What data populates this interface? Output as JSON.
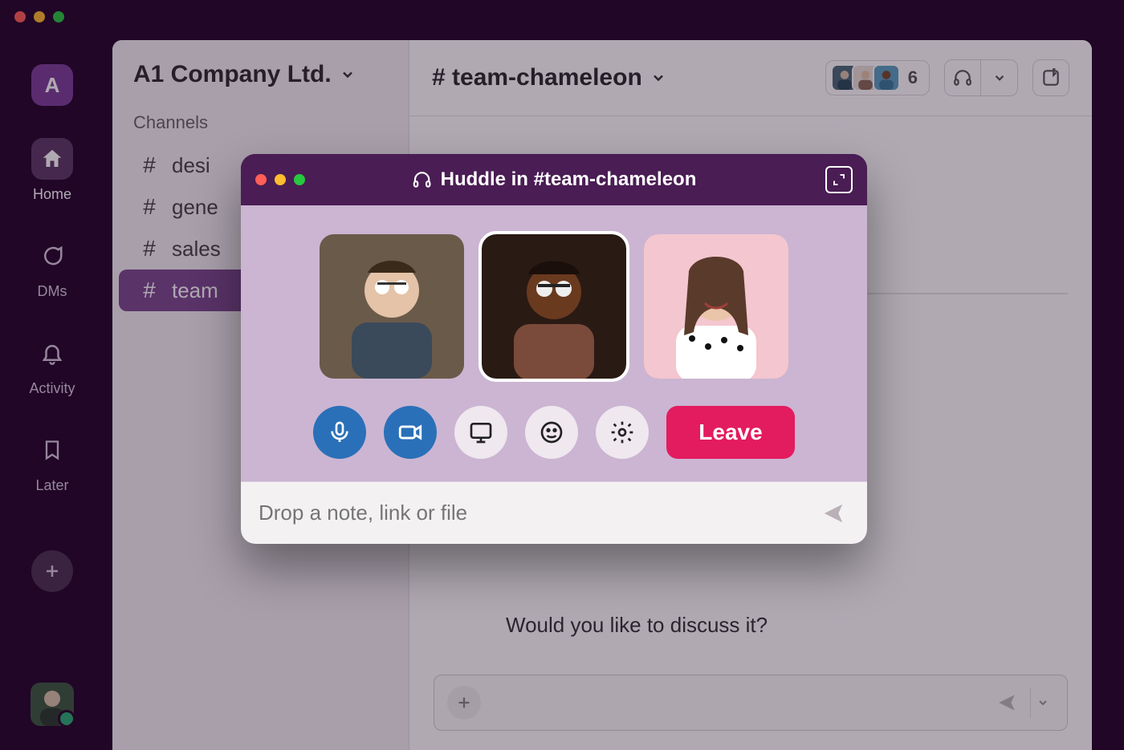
{
  "workspace": {
    "badge_letter": "A",
    "name": "A1 Company Ltd."
  },
  "rail": {
    "items": [
      {
        "id": "home",
        "label": "Home",
        "icon": "home-icon",
        "active": true
      },
      {
        "id": "dms",
        "label": "DMs",
        "icon": "dms-icon",
        "active": false
      },
      {
        "id": "activity",
        "label": "Activity",
        "icon": "bell-icon",
        "active": false
      },
      {
        "id": "later",
        "label": "Later",
        "icon": "bookmark-icon",
        "active": false
      }
    ]
  },
  "sidebar": {
    "section_label": "Channels",
    "channels": [
      {
        "name": "desi",
        "full": "design",
        "active": false
      },
      {
        "name": "gene",
        "full": "general",
        "active": false
      },
      {
        "name": "sales",
        "full": "sales",
        "active": false
      },
      {
        "name": "team",
        "full": "team-chameleon",
        "active": true
      }
    ]
  },
  "channel": {
    "name": "team-chameleon",
    "display": "# team-chameleon",
    "member_count": "6",
    "body_message": "Would you like to discuss it?"
  },
  "huddle": {
    "title": "Huddle in #team-chameleon",
    "note_placeholder": "Drop a note, link or file",
    "leave_label": "Leave",
    "participants": [
      {
        "id": "p1",
        "speaking": false
      },
      {
        "id": "p2",
        "speaking": true
      },
      {
        "id": "p3",
        "speaking": false
      }
    ],
    "controls": {
      "mic": "mic-icon",
      "camera": "camera-icon",
      "screen": "screen-share-icon",
      "emoji": "emoji-icon",
      "settings": "gear-icon"
    }
  },
  "colors": {
    "rail_bg": "#24062a",
    "workspace_badge": "#7c3f98",
    "huddle_bg": "#cbb5d2",
    "huddle_header": "#4a1d54",
    "leave_button": "#e31b5f",
    "control_active": "#2a70b8"
  }
}
